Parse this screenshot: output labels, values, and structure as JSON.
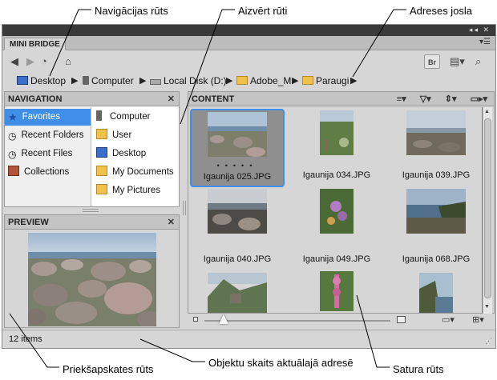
{
  "annotations": {
    "navigation_pane": "Navigācijas rūts",
    "close_pane": "Aizvērt rūti",
    "address_bar": "Adreses josla",
    "preview_pane": "Priekšapskates rūts",
    "item_count": "Objektu skaits aktuālajā adresē",
    "content_pane": "Satura rūts"
  },
  "panel": {
    "tab_title": "MINI BRIDGE",
    "bridge_button": "Br"
  },
  "address_bar": {
    "crumbs": [
      "Desktop",
      "Computer",
      "Local Disk (D:)",
      "Adobe_M",
      "Paraugi"
    ]
  },
  "navigation": {
    "title": "NAVIGATION",
    "left_items": [
      "Favorites",
      "Recent Folders",
      "Recent Files",
      "Collections"
    ],
    "right_items": [
      "Computer",
      "User",
      "Desktop",
      "My Documents",
      "My Pictures"
    ],
    "selected": "Favorites"
  },
  "preview": {
    "title": "PREVIEW"
  },
  "content": {
    "title": "CONTENT",
    "items": [
      "Igaunija 025.JPG",
      "Igaunija 034.JPG",
      "Igaunija 039.JPG",
      "Igaunija 040.JPG",
      "Igaunija 049.JPG",
      "Igaunija 068.JPG",
      "",
      "",
      ""
    ]
  },
  "status": {
    "item_count": "12 items"
  },
  "colors": {
    "selection": "#3f8ee8",
    "panel_bg": "#d6d6d6",
    "header_bg": "#c4c4c4"
  }
}
